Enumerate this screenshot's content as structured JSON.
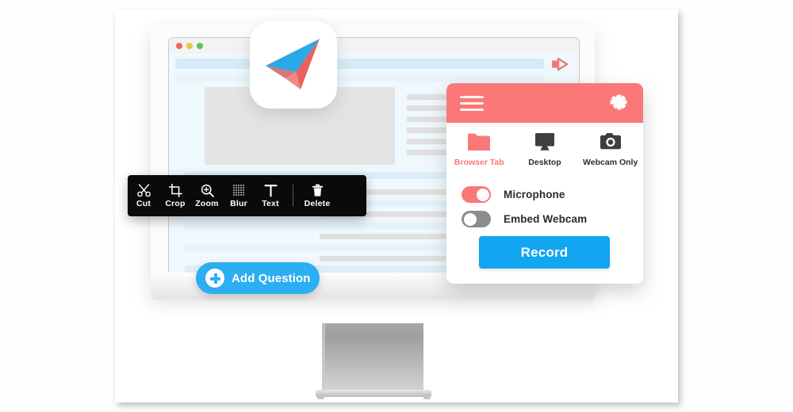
{
  "browser": {
    "traffic_lights": [
      "close-red",
      "minimize-yellow",
      "maximize-green"
    ],
    "address_bar_placeholder": "",
    "play_icon": "play-icon"
  },
  "logo": {
    "name": "paper-plane-logo",
    "colors": {
      "blue": "#29a9e8",
      "red": "#e8615f",
      "pink": "#f08a87"
    }
  },
  "toolbar": {
    "items": [
      {
        "label": "Cut",
        "icon": "scissors-icon"
      },
      {
        "label": "Crop",
        "icon": "crop-icon"
      },
      {
        "label": "Zoom",
        "icon": "magnifier-plus-icon"
      },
      {
        "label": "Blur",
        "icon": "blur-dots-icon"
      },
      {
        "label": "Text",
        "icon": "text-t-icon"
      }
    ],
    "delete": {
      "label": "Delete",
      "icon": "trash-icon"
    },
    "background": "#0a0a0a"
  },
  "add_question": {
    "label": "Add Question",
    "icon": "plus-circle-icon",
    "color": "#2caef2"
  },
  "panel": {
    "header": {
      "menu_icon": "hamburger-menu-icon",
      "settings_icon": "gear-icon",
      "color": "#fa7878"
    },
    "sources": [
      {
        "label": "Browser Tab",
        "icon": "folder-icon",
        "active": true
      },
      {
        "label": "Desktop",
        "icon": "monitor-icon",
        "active": false
      },
      {
        "label": "Webcam Only",
        "icon": "camera-icon",
        "active": false
      }
    ],
    "toggles": [
      {
        "label": "Microphone",
        "state": "on",
        "name": "microphone-toggle"
      },
      {
        "label": "Embed Webcam",
        "state": "off",
        "name": "embed-webcam-toggle"
      }
    ],
    "record_button": {
      "label": "Record",
      "color": "#12a5f0"
    }
  },
  "colors": {
    "coral": "#fa7878",
    "blue": "#12a5f0",
    "pill_blue": "#2caef2",
    "toolbar_black": "#0a0a0a",
    "screen_bg": "#eef8fd"
  }
}
